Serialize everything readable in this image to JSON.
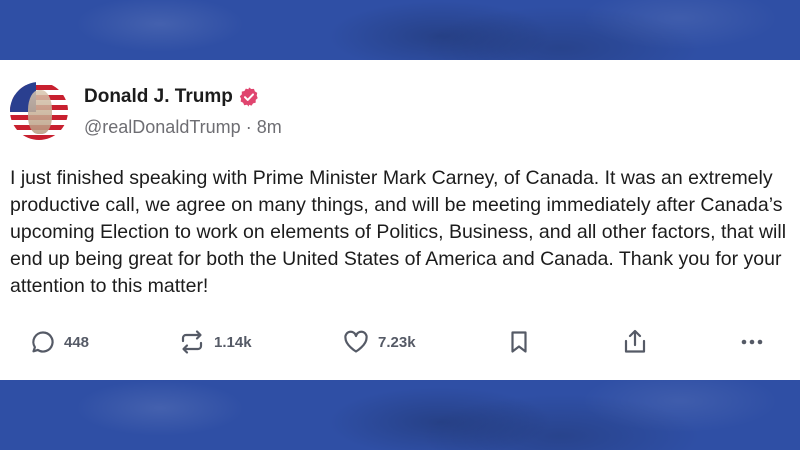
{
  "post": {
    "author_name": "Donald J. Trump",
    "handle": "@realDonaldTrump",
    "separator": "·",
    "time": "8m",
    "text": "I just finished speaking with Prime Minister Mark Carney, of Canada. It was an extremely productive call, we agree on many things, and will be meeting immediately after Canada’s upcoming Election to work on elements of Politics, Business, and all other factors, that will end up being great for both the United States of America and Canada. Thank you for your attention to this matter!",
    "verified_color": "#e0456f"
  },
  "actions": {
    "replies": "448",
    "reposts": "1.14k",
    "likes": "7.23k"
  },
  "icons": {
    "reply": "comment-icon",
    "repost": "repost-icon",
    "like": "heart-icon",
    "bookmark": "bookmark-icon",
    "share": "share-icon",
    "more": "more-icon"
  },
  "colors": {
    "background": "#2f4fa5",
    "card": "#ffffff",
    "text": "#1c1c1c",
    "muted": "#6e6e73"
  }
}
